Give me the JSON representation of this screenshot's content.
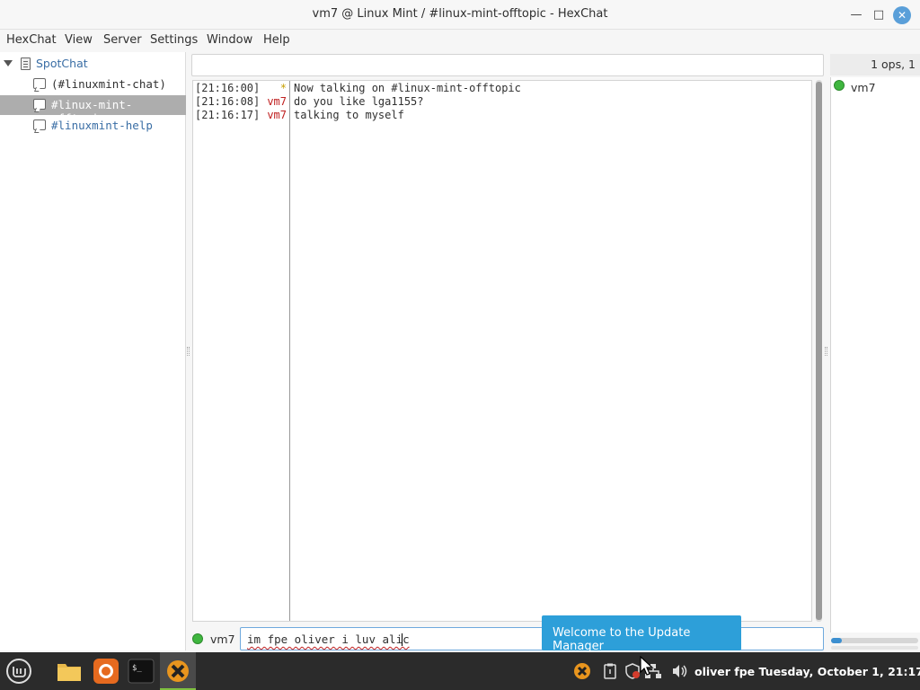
{
  "window": {
    "title": "vm7 @ Linux Mint / #linux-mint-offtopic - HexChat"
  },
  "menu": [
    "HexChat",
    "View",
    "Server",
    "Settings",
    "Window",
    "Help"
  ],
  "tree": {
    "server": "SpotChat",
    "channels": [
      {
        "label": "(#linuxmint-chat)",
        "state": "inactive"
      },
      {
        "label": "#linux-mint-offtopic",
        "state": "selected"
      },
      {
        "label": "#linuxmint-help",
        "state": "new-data"
      }
    ]
  },
  "topic": "",
  "messages": [
    {
      "time": "[21:16:00]",
      "nick": "*",
      "text": "Now talking on #linux-mint-offtopic"
    },
    {
      "time": "[21:16:08]",
      "nick": "vm7",
      "text": "do you like lga1155?"
    },
    {
      "time": "[21:16:17]",
      "nick": "vm7",
      "text": "talking to myself"
    }
  ],
  "userlist": {
    "header": "1 ops, 1",
    "users": [
      "vm7"
    ]
  },
  "input": {
    "nick": "vm7",
    "value": "im fpe oliver i luv alic"
  },
  "toast": {
    "text": "Welcome to the Update Manager"
  },
  "taskbar": {
    "apps": [
      "mint-menu-icon",
      "files-icon",
      "firefox-icon",
      "terminal-icon",
      "hexchat-icon"
    ],
    "clock": "oliver fpe Tuesday, October  1, 21:17"
  },
  "colors": {
    "accent": "#2d9fd9",
    "nick": "#c02020",
    "selection": "#adadad",
    "taskbar": "#2b2b2b"
  }
}
